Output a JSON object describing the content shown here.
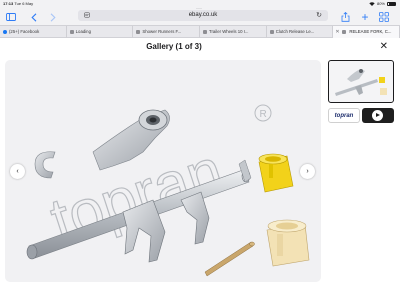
{
  "status": {
    "time": "17:13",
    "date": "Tue 6 May",
    "battery": "80%"
  },
  "toolbar": {
    "url": "ebay.co.uk",
    "reload_icon": "reload-icon",
    "dots": "···"
  },
  "tabs": [
    {
      "label": "(25+) Facebook",
      "favicon_color": "#1877f2"
    },
    {
      "label": "Loading",
      "favicon_color": "#8e8e93"
    },
    {
      "label": "Shower Runners F...",
      "favicon_color": "#8e8e93"
    },
    {
      "label": "Trailer Wheels 10 I...",
      "favicon_color": "#8e8e93"
    },
    {
      "label": "Clutch Release Le...",
      "favicon_color": "#8e8e93"
    },
    {
      "label": "RELEASE FORK, C...",
      "favicon_color": "#8e8e93"
    }
  ],
  "gallery": {
    "title": "Gallery (1 of 3)",
    "close": "✕",
    "prev": "‹",
    "next": "›",
    "watermark": "topran",
    "thumb_brand": "topran"
  },
  "colors": {
    "accent": "#2f7cf6",
    "yellow_bushing": "#f2d21a",
    "cream_bushing": "#f3e2b5",
    "metal": "#c9cdd2"
  }
}
